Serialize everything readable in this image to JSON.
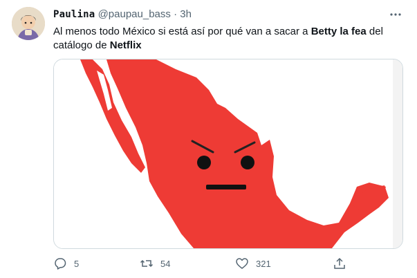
{
  "tweet": {
    "author_name": "Paulina",
    "handle": "@paupau_bass",
    "separator": "·",
    "time": "3h",
    "text_part1": "Al menos todo México si está así por qué van a sacar a ",
    "text_bold1": "Betty la fea",
    "text_part2": " del catálogo de ",
    "text_bold2": "Netflix"
  },
  "stats": {
    "replies": "5",
    "retweets": "54",
    "likes": "321"
  },
  "colors": {
    "map_red": "#ee3b35",
    "text_secondary": "#536471",
    "border": "#cfd9de"
  },
  "icons": [
    "avatar",
    "more-icon",
    "reply-icon",
    "retweet-icon",
    "like-icon",
    "share-icon"
  ]
}
